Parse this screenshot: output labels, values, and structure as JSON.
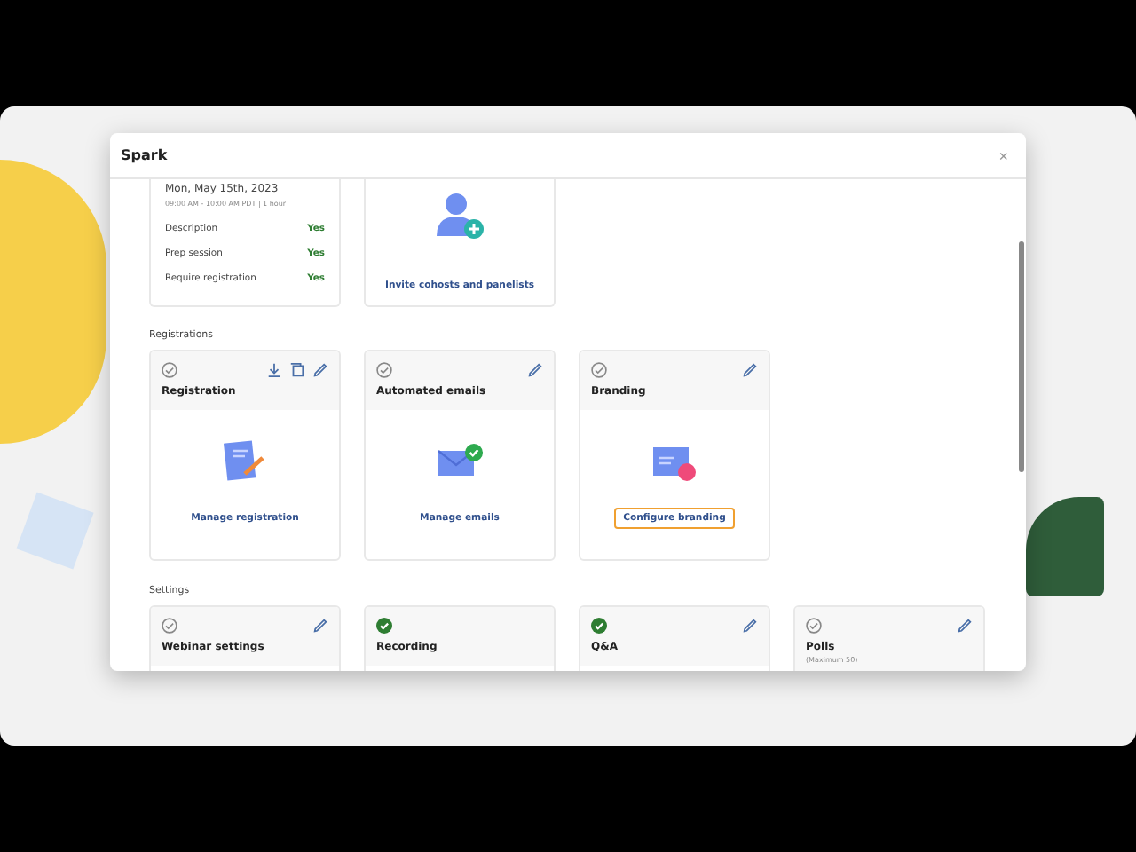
{
  "window": {
    "title": "Spark",
    "close": "×"
  },
  "summary_card": {
    "date": "Mon, May 15th, 2023",
    "time": "09:00 AM - 10:00 AM PDT | 1 hour",
    "rows": [
      {
        "label": "Description",
        "value": "Yes"
      },
      {
        "label": "Prep session",
        "value": "Yes"
      },
      {
        "label": "Require registration",
        "value": "Yes"
      }
    ]
  },
  "invite_card": {
    "link": "Invite cohosts and panelists"
  },
  "sections": [
    {
      "title": "Registrations",
      "cards": [
        {
          "title": "Registration",
          "done": false,
          "downloadable": true,
          "editable": true,
          "link": "Manage registration",
          "focused": false
        },
        {
          "title": "Automated emails",
          "done": false,
          "downloadable": false,
          "editable": true,
          "link": "Manage emails",
          "focused": false
        },
        {
          "title": "Branding",
          "done": false,
          "downloadable": false,
          "editable": true,
          "link": "Configure branding",
          "focused": true
        }
      ]
    },
    {
      "title": "Settings",
      "cards": [
        {
          "title": "Webinar settings",
          "done": false,
          "editable": true
        },
        {
          "title": "Recording",
          "done": true,
          "editable": false
        },
        {
          "title": "Q&A",
          "done": true,
          "editable": true
        },
        {
          "title": "Polls",
          "subtitle": "(Maximum 50)",
          "done": false,
          "editable": true
        }
      ]
    }
  ]
}
